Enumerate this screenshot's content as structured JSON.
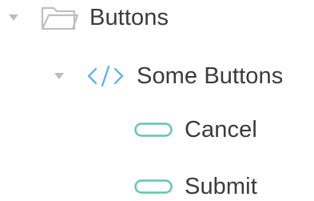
{
  "tree": {
    "group": {
      "icon": "folder-icon",
      "label": "Buttons",
      "expanded": true
    },
    "component": {
      "icon": "code-icon",
      "label": "Some Buttons",
      "expanded": true
    },
    "items": [
      {
        "icon": "button-icon",
        "label": "Cancel"
      },
      {
        "icon": "button-icon",
        "label": "Submit"
      }
    ]
  },
  "colors": {
    "text": "#3b3b3b",
    "toggle": "#bdbdbd",
    "folder": "#bfbfbf",
    "code": "#56aee6",
    "button": "#5fc7a9"
  }
}
